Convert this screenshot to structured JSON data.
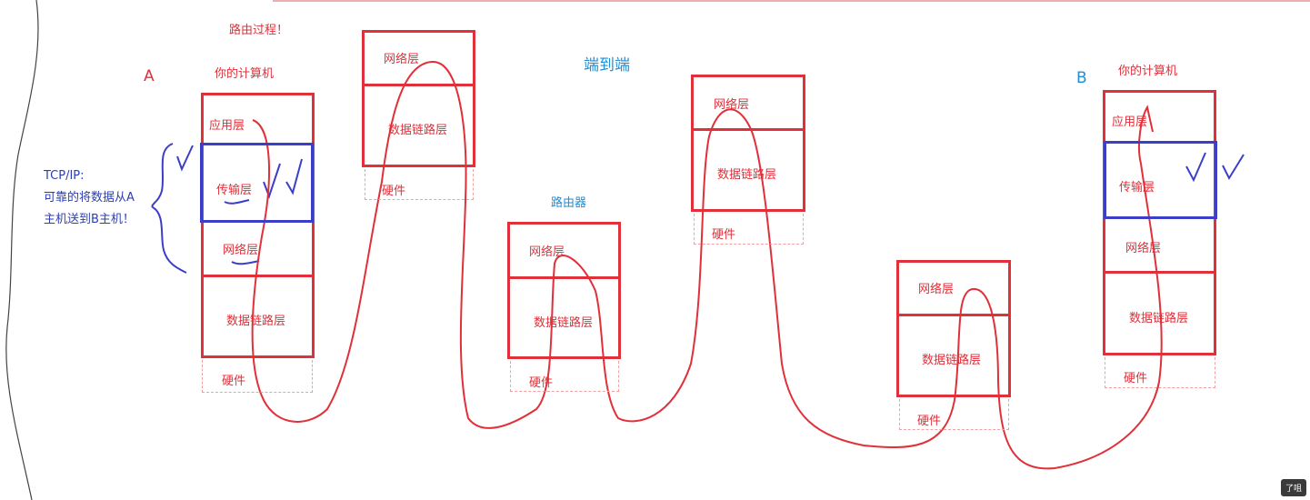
{
  "title": "路由过程！",
  "center_label": "端到端",
  "router_label": "路由器",
  "host_a": {
    "letter": "A",
    "name": "你的计算机"
  },
  "host_b": {
    "letter": "B",
    "name": "你的计算机"
  },
  "tcpip_note": [
    "TCP/IP:",
    "可靠的将数据从A",
    "主机送到B主机！"
  ],
  "layers": {
    "app": "应用层",
    "transport": "传输层",
    "network": "网络层",
    "datalink": "数据链路层",
    "hardware": "硬件"
  },
  "badge": "了咀"
}
